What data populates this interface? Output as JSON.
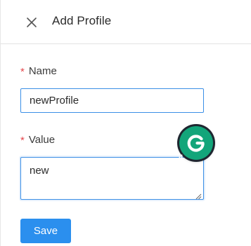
{
  "header": {
    "title": "Add Profile",
    "close_icon": "close-icon"
  },
  "form": {
    "name": {
      "required_mark": "*",
      "label": "Name",
      "value": "newProfile"
    },
    "value": {
      "required_mark": "*",
      "label": "Value",
      "value": "new"
    }
  },
  "grammarly": {
    "icon": "grammarly-icon",
    "letter": "G",
    "color": "#13a57a"
  },
  "actions": {
    "save_label": "Save"
  },
  "colors": {
    "accent": "#2b8fee",
    "required": "#e5484d",
    "input_border": "#3b8fe6"
  }
}
